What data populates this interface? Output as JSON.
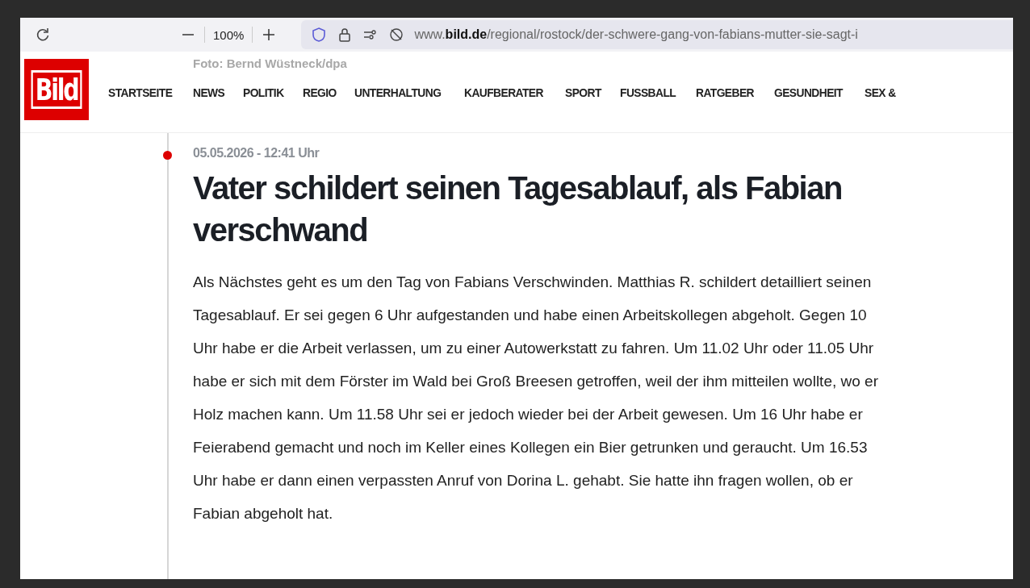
{
  "browser": {
    "zoom": "100%",
    "url": "www.**bild.de**/regional/rostock/der-schwere-gang-von-fabians-mutter-sie-sagt-i"
  },
  "photo_credit": "Foto: Bernd Wüstneck/dpa",
  "site": {
    "logo": "Bild",
    "nav": [
      "STARTSEITE",
      "NEWS",
      "POLITIK",
      "REGIO",
      "UNTERHALTUNG",
      "KAUFBERATER",
      "SPORT",
      "FUSSBALL",
      "RATGEBER",
      "GESUNDHEIT",
      "SEX &"
    ]
  },
  "article": {
    "timestamp": "05.05.2026 - 12:41 Uhr",
    "title": "Vater schildert seinen Tagesablauf, als Fabian verschwand",
    "body": "Als Nächstes geht es um den Tag von Fabians Verschwinden. Matthias R. schildert detailliert seinen Tagesablauf. Er sei gegen 6 Uhr aufgestanden und habe einen Arbeitskollegen abgeholt. Gegen 10 Uhr habe er die Arbeit verlassen, um zu einer Autowerkstatt zu fahren. Um 11.02 Uhr oder 11.05 Uhr habe er sich mit dem Förster im Wald bei Groß Breesen getroffen, weil der ihm mitteilen wollte, wo er Holz machen kann. Um 11.58 Uhr sei er jedoch wieder bei der Arbeit gewesen. Um 16 Uhr habe er Feierabend gemacht und noch im Keller eines Kollegen ein Bier getrunken und geraucht. Um 16.53 Uhr habe er dann einen verpassten Anruf von Dorina L. gehabt. Sie hatte ihn fragen wollen, ob er Fabian abgeholt hat."
  }
}
